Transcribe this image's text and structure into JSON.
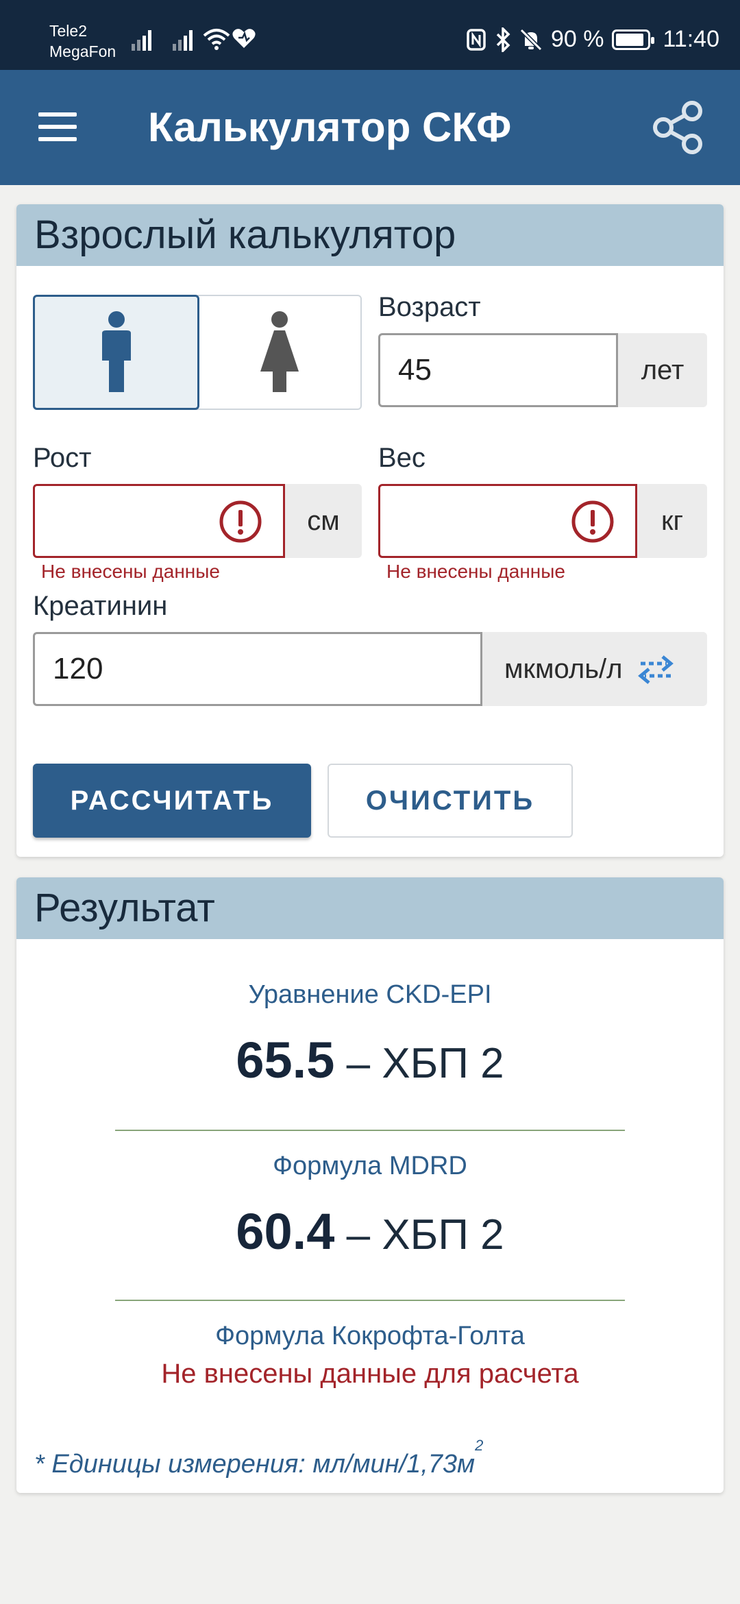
{
  "status_bar": {
    "carrier_1": "Tele2",
    "carrier_2": "MegaFon",
    "battery_percent": "90 %",
    "time": "11:40"
  },
  "app_bar": {
    "title": "Калькулятор СКФ",
    "menu_icon": "hamburger-menu-icon",
    "share_icon": "share-icon"
  },
  "calculator": {
    "header": "Взрослый калькулятор",
    "sex_options": [
      {
        "icon": "male-icon",
        "selected": true
      },
      {
        "icon": "female-icon",
        "selected": false
      }
    ],
    "age": {
      "label": "Возраст",
      "value": "45",
      "unit": "лет"
    },
    "height": {
      "label": "Рост",
      "value": "",
      "unit": "см",
      "error": "Не внесены данные"
    },
    "weight": {
      "label": "Вес",
      "value": "",
      "unit": "кг",
      "error": "Не внесены данные"
    },
    "creatinine": {
      "label": "Креатинин",
      "value": "120",
      "unit": "мкмоль/л",
      "swap_icon": "swap-units-icon"
    },
    "calculate_button": "РАССЧИТАТЬ",
    "clear_button": "ОЧИСТИТЬ"
  },
  "result": {
    "header": "Результат",
    "ckd_epi": {
      "label": "Уравнение CKD-EPI",
      "value": "65.5",
      "stage": " – ХБП 2"
    },
    "mdrd": {
      "label": "Формула MDRD",
      "value": "60.4",
      "stage": " – ХБП 2"
    },
    "cockcroft": {
      "label": "Формула Кокрофта-Голта",
      "message": "Не внесены данные для расчета"
    },
    "units_note": "* Единицы измерения: мл/мин/1,73м",
    "units_sup": "2"
  },
  "colors": {
    "status_bar": "#14283f",
    "app_bar": "#2d5d8b",
    "section_header": "#aec7d6",
    "error": "#a3242a"
  }
}
